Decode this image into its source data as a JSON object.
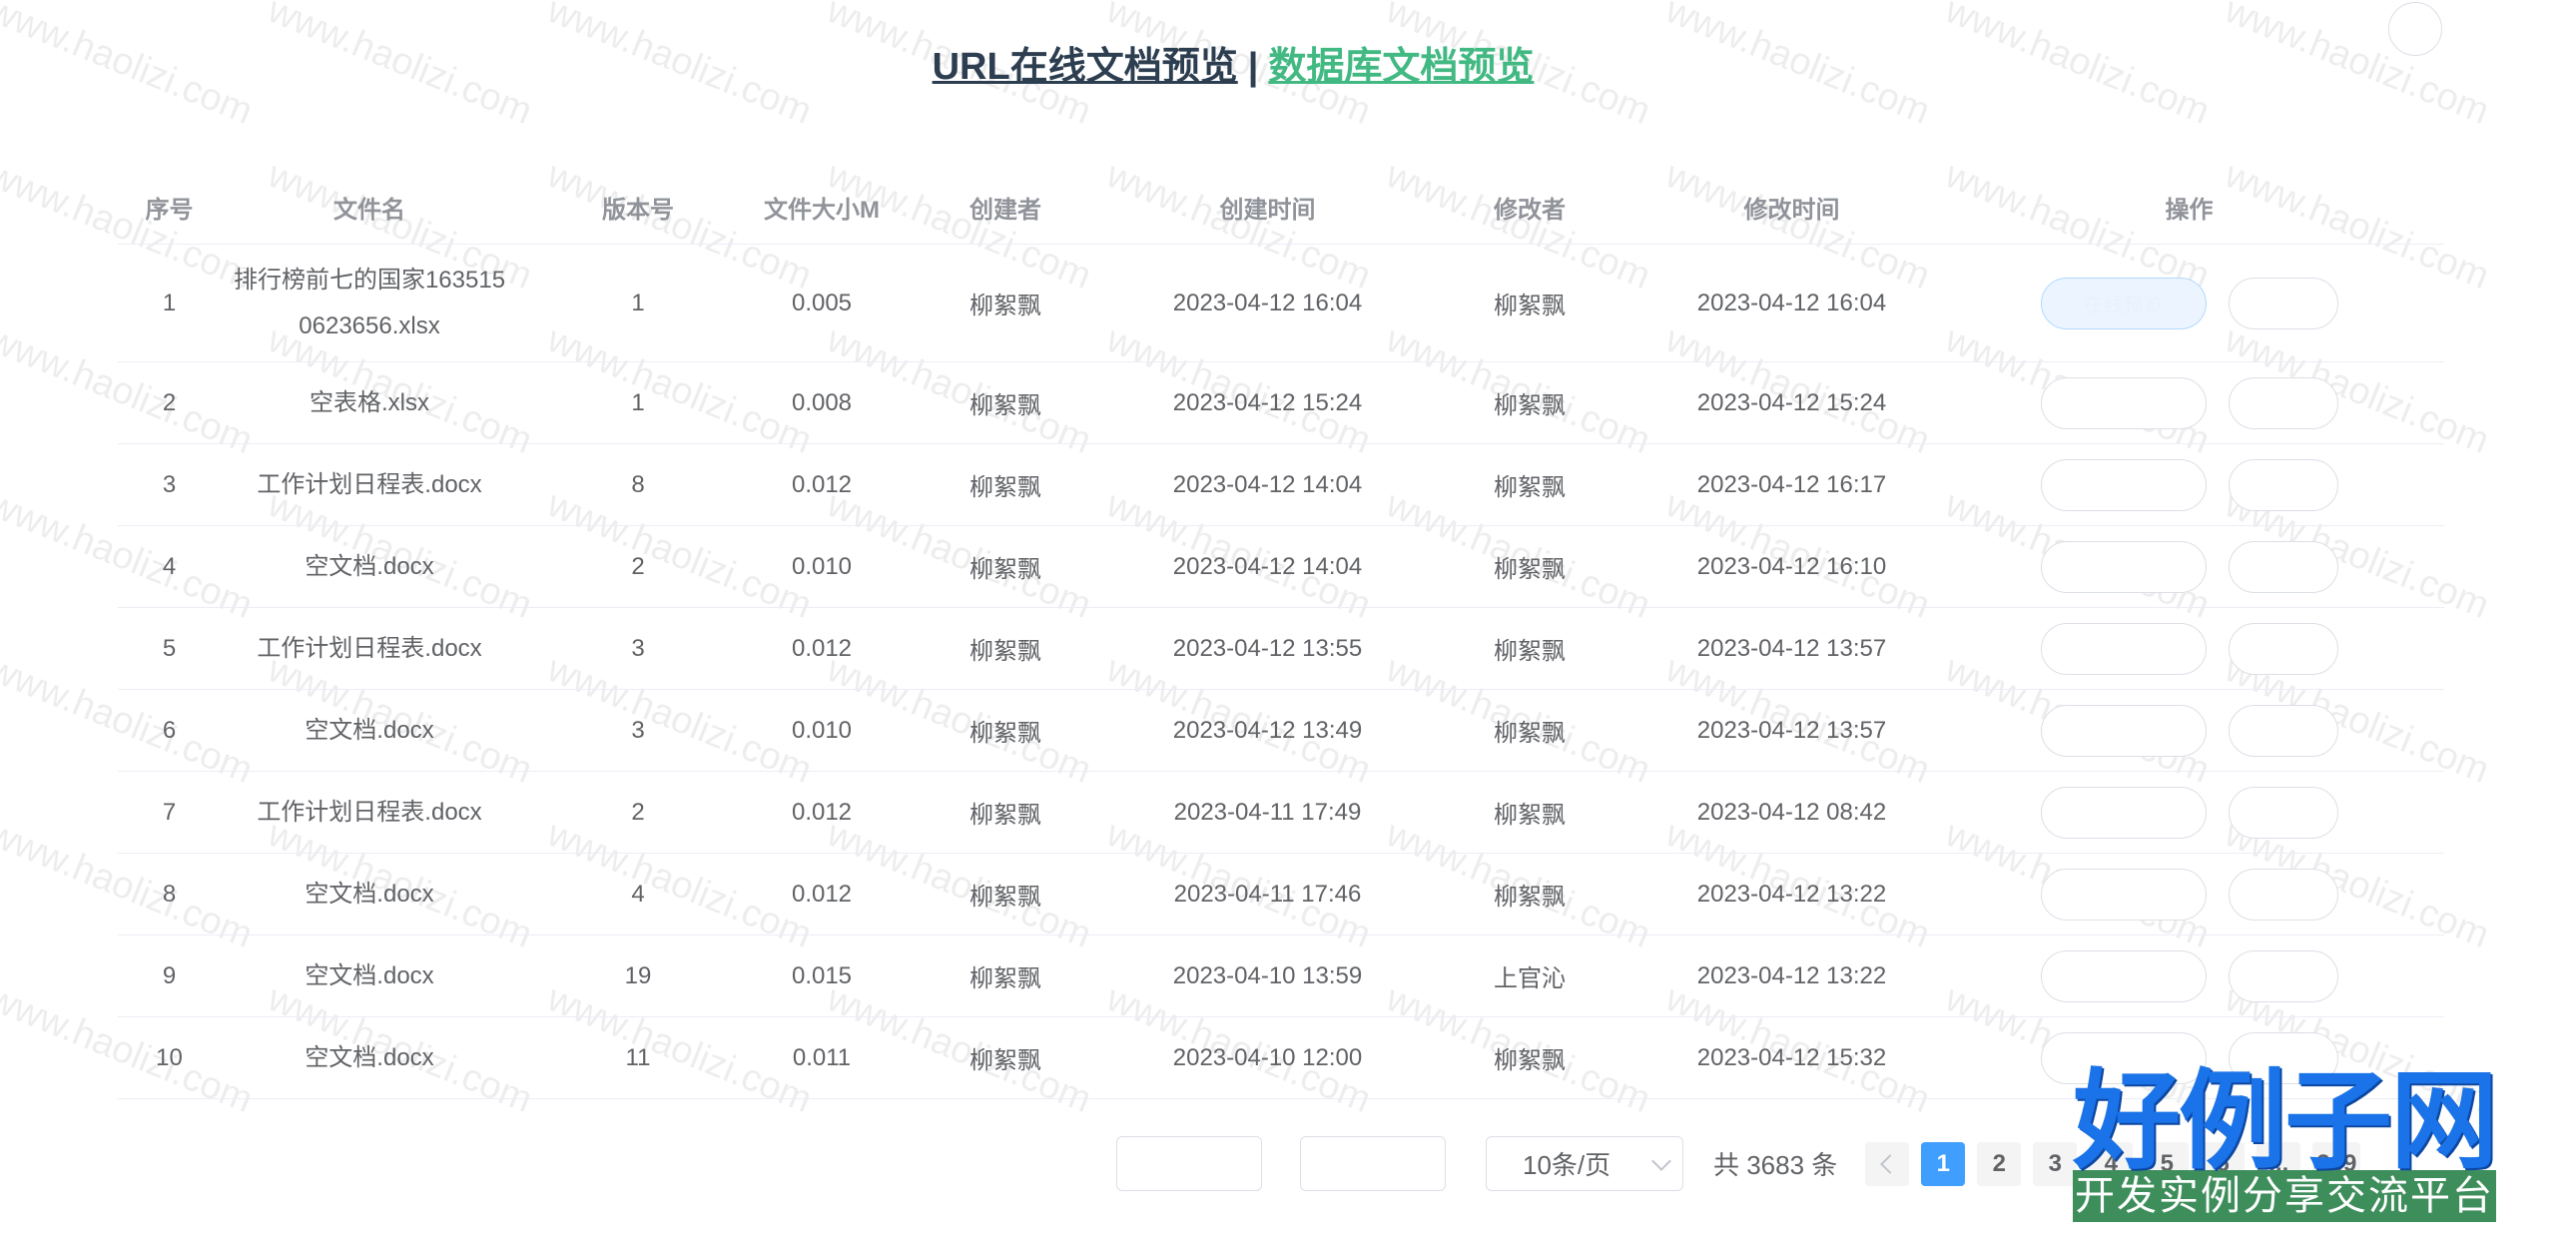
{
  "watermark": "www.haolizi.com",
  "header": {
    "url_preview_link": "URL在线文档预览",
    "separator": "|",
    "db_preview_link": "数据库文档预览"
  },
  "table": {
    "columns": [
      "序号",
      "文件名",
      "版本号",
      "文件大小M",
      "创建者",
      "创建时间",
      "修改者",
      "修改时间",
      "操作"
    ],
    "rows": [
      {
        "index": "1",
        "name": "排行榜前七的国家1635150623656.xlsx",
        "version": "1",
        "size": "0.005",
        "creator": "柳絮飘",
        "created": "2023-04-12 16:04",
        "modifier": "柳絮飘",
        "modified": "2023-04-12 16:04"
      },
      {
        "index": "2",
        "name": "空表格.xlsx",
        "version": "1",
        "size": "0.008",
        "creator": "柳絮飘",
        "created": "2023-04-12 15:24",
        "modifier": "柳絮飘",
        "modified": "2023-04-12 15:24"
      },
      {
        "index": "3",
        "name": "工作计划日程表.docx",
        "version": "8",
        "size": "0.012",
        "creator": "柳絮飘",
        "created": "2023-04-12 14:04",
        "modifier": "柳絮飘",
        "modified": "2023-04-12 16:17"
      },
      {
        "index": "4",
        "name": "空文档.docx",
        "version": "2",
        "size": "0.010",
        "creator": "柳絮飘",
        "created": "2023-04-12 14:04",
        "modifier": "柳絮飘",
        "modified": "2023-04-12 16:10"
      },
      {
        "index": "5",
        "name": "工作计划日程表.docx",
        "version": "3",
        "size": "0.012",
        "creator": "柳絮飘",
        "created": "2023-04-12 13:55",
        "modifier": "柳絮飘",
        "modified": "2023-04-12 13:57"
      },
      {
        "index": "6",
        "name": "空文档.docx",
        "version": "3",
        "size": "0.010",
        "creator": "柳絮飘",
        "created": "2023-04-12 13:49",
        "modifier": "柳絮飘",
        "modified": "2023-04-12 13:57"
      },
      {
        "index": "7",
        "name": "工作计划日程表.docx",
        "version": "2",
        "size": "0.012",
        "creator": "柳絮飘",
        "created": "2023-04-11 17:49",
        "modifier": "柳絮飘",
        "modified": "2023-04-12 08:42"
      },
      {
        "index": "8",
        "name": "空文档.docx",
        "version": "4",
        "size": "0.012",
        "creator": "柳絮飘",
        "created": "2023-04-11 17:46",
        "modifier": "柳絮飘",
        "modified": "2023-04-12 13:22"
      },
      {
        "index": "9",
        "name": "空文档.docx",
        "version": "19",
        "size": "0.015",
        "creator": "柳絮飘",
        "created": "2023-04-10 13:59",
        "modifier": "上官沁",
        "modified": "2023-04-12 13:22"
      },
      {
        "index": "10",
        "name": "空文档.docx",
        "version": "11",
        "size": "0.011",
        "creator": "柳絮飘",
        "created": "2023-04-10 12:00",
        "modifier": "柳絮飘",
        "modified": "2023-04-12 15:32"
      }
    ],
    "preview_button_label": "在线预览"
  },
  "pagination": {
    "page_size_label": "10条/页",
    "total_label": "共 3683 条",
    "pages": [
      "1",
      "2",
      "3",
      "4",
      "5",
      "6",
      "...",
      "369"
    ],
    "active_page": "1"
  },
  "brand": {
    "main": "好例子网",
    "sub": "开发实例分享交流平台"
  },
  "colors": {
    "title_dark": "#2c3e50",
    "title_green": "#42b983",
    "active_page": "#409eff",
    "brand_blue": "#1a73e8",
    "brand_green": "#3e8e5b"
  }
}
